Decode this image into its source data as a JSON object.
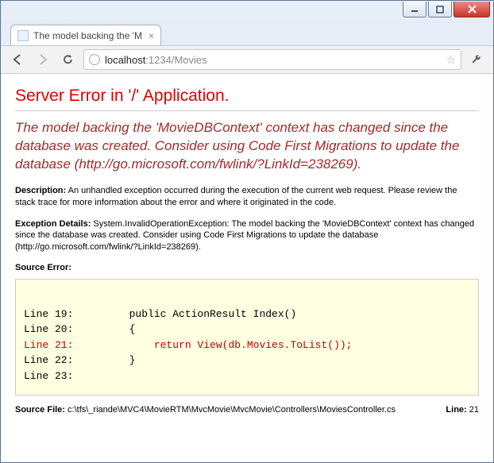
{
  "window": {
    "title": "The model backing the 'M"
  },
  "tab": {
    "title": "The model backing the 'M"
  },
  "toolbar": {
    "url_host": "localhost",
    "url_port_path": ":1234/Movies"
  },
  "error": {
    "heading": "Server Error in '/' Application.",
    "subheading": "The model backing the 'MovieDBContext' context has changed since the database was created. Consider using Code First Migrations to update the database (http://go.microsoft.com/fwlink/?LinkId=238269).",
    "description_label": "Description:",
    "description_text": " An unhandled exception occurred during the execution of the current web request. Please review the stack trace for more information about the error and where it originated in the code.",
    "exception_label": "Exception Details:",
    "exception_text": " System.InvalidOperationException: The model backing the 'MovieDBContext' context has changed since the database was created. Consider using Code First Migrations to update the database (http://go.microsoft.com/fwlink/?LinkId=238269).",
    "source_error_label": "Source Error:",
    "code": {
      "l19": "Line 19:         public ActionResult Index()",
      "l20": "Line 20:         {",
      "l21": "Line 21:             return View(db.Movies.ToList());",
      "l22": "Line 22:         }",
      "l23": "Line 23:"
    },
    "source_file_label": "Source File:",
    "source_file_path": " c:\\tfs\\_riande\\MVC4\\MovieRTM\\MvcMovie\\MvcMovie\\Controllers\\MoviesController.cs",
    "line_label": "Line:",
    "line_value": " 21"
  }
}
